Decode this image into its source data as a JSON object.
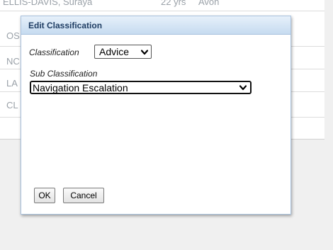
{
  "background_rows": [
    {
      "name": "ELLIS-DAVIS, Suraya",
      "age": "22 yrs",
      "location": "Avon"
    },
    {
      "name": "OS"
    },
    {
      "name": "NC"
    },
    {
      "name": "LA"
    },
    {
      "name": "CL"
    }
  ],
  "dialog": {
    "title": "Edit Classification",
    "classification_label": "Classification",
    "classification_value": "Advice",
    "subclassification_label": "Sub Classification",
    "subclassification_value": "Navigation Escalation",
    "ok_label": "OK",
    "cancel_label": "Cancel"
  },
  "icons": {
    "dropdown": "chevron-down-icon"
  }
}
